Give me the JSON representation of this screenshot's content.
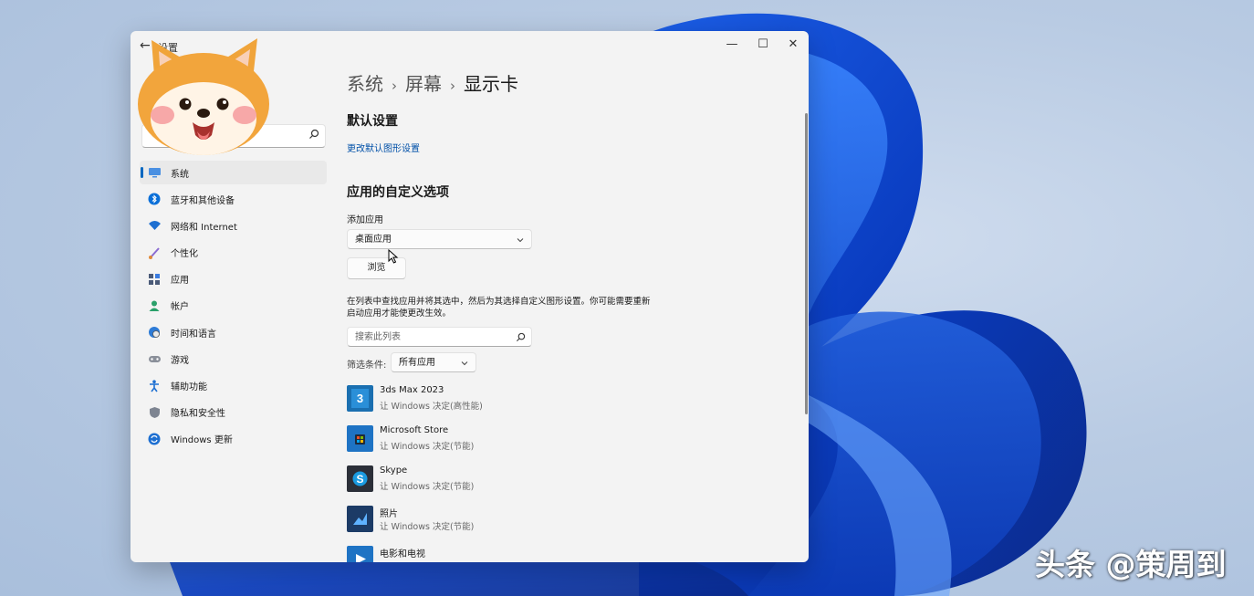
{
  "window": {
    "title": "设置",
    "back_glyph": "←",
    "minimize_glyph": "—",
    "maximize_glyph": "☐",
    "close_glyph": "✕"
  },
  "sidebar": {
    "search_icon": "search-icon",
    "items": [
      {
        "label": "系统",
        "icon": "monitor-icon",
        "active": true
      },
      {
        "label": "蓝牙和其他设备",
        "icon": "bluetooth-icon"
      },
      {
        "label": "网络和 Internet",
        "icon": "wifi-icon"
      },
      {
        "label": "个性化",
        "icon": "brush-icon"
      },
      {
        "label": "应用",
        "icon": "apps-icon"
      },
      {
        "label": "帐户",
        "icon": "person-icon"
      },
      {
        "label": "时间和语言",
        "icon": "clock-globe-icon"
      },
      {
        "label": "游戏",
        "icon": "gamepad-icon"
      },
      {
        "label": "辅助功能",
        "icon": "accessibility-icon"
      },
      {
        "label": "隐私和安全性",
        "icon": "shield-icon"
      },
      {
        "label": "Windows 更新",
        "icon": "update-icon"
      }
    ]
  },
  "breadcrumb": {
    "items": [
      "系统",
      "屏幕",
      "显示卡"
    ],
    "separator": "›"
  },
  "default_settings": {
    "title": "默认设置",
    "link": "更改默认图形设置"
  },
  "custom_options": {
    "title": "应用的自定义选项",
    "add_app_label": "添加应用",
    "app_type_selected": "桌面应用",
    "browse_label": "浏览",
    "description": "在列表中查找应用并将其选中，然后为其选择自定义图形设置。你可能需要重新启动应用才能使更改生效。",
    "list_search_placeholder": "搜索此列表",
    "filter_label": "筛选条件:",
    "filter_selected": "所有应用"
  },
  "apps": [
    {
      "name": "3ds Max 2023",
      "preference": "让 Windows 决定(高性能)",
      "icon": "3dsmax-icon",
      "color": "#1a6fb0"
    },
    {
      "name": "Microsoft Store",
      "preference": "让 Windows 决定(节能)",
      "icon": "store-icon",
      "color": "#1e73c4"
    },
    {
      "name": "Skype",
      "preference": "让 Windows 决定(节能)",
      "icon": "skype-icon",
      "color": "#2b2f38"
    },
    {
      "name": "照片",
      "preference": "让 Windows 决定(节能)",
      "icon": "photos-icon",
      "color": "#1c3b66"
    },
    {
      "name": "电影和电视",
      "preference": "",
      "icon": "movies-icon",
      "color": "#1e73c4"
    }
  ],
  "watermark": "头条 @策周到",
  "colors": {
    "accent": "#0067c0",
    "link": "#0050a8",
    "window_bg": "#f3f3f3"
  }
}
